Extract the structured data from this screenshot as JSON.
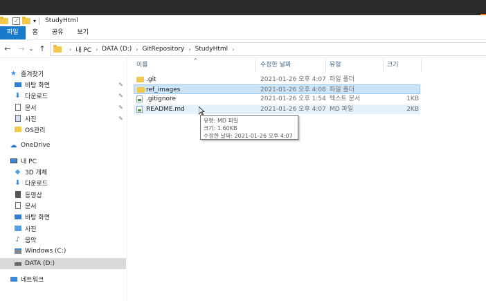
{
  "window": {
    "title": "StudyHtml"
  },
  "ribbon": {
    "tabs": [
      "파일",
      "홈",
      "공유",
      "보기"
    ]
  },
  "address": {
    "crumbs": [
      "내 PC",
      "DATA (D:)",
      "GitRepository",
      "StudyHtml"
    ]
  },
  "sidebar": {
    "quick_access": "즐겨찾기",
    "quick_items": [
      "바탕 화면",
      "다운로드",
      "문서",
      "사진",
      "OS관리"
    ],
    "onedrive": "OneDrive",
    "this_pc": "내 PC",
    "pc_items": [
      "3D 개체",
      "다운로드",
      "동영상",
      "문서",
      "바탕 화면",
      "사진",
      "음악",
      "Windows (C:)",
      "DATA (D:)"
    ],
    "network": "네트워크"
  },
  "columns": {
    "name": "이름",
    "date": "수정한 날짜",
    "type": "유형",
    "size": "크기"
  },
  "files": [
    {
      "name": ".git",
      "date": "2021-01-26 오후 4:07",
      "type": "파일 폴더",
      "size": ""
    },
    {
      "name": "ref_images",
      "date": "2021-01-26 오후 4:08",
      "type": "파일 폴더",
      "size": ""
    },
    {
      "name": ".gitignore",
      "date": "2021-01-26 오후 1:54",
      "type": "텍스트 문서",
      "size": "1KB"
    },
    {
      "name": "README.md",
      "date": "2021-01-26 오후 4:07",
      "type": "MD 파일",
      "size": "2KB"
    }
  ],
  "tooltip": {
    "line1": "유형: MD 파일",
    "line2": "크기: 1.60KB",
    "line3": "수정한 날짜: 2021-01-26 오후 4:07"
  },
  "colors": {
    "accent": "#1979ca",
    "selection": "#cce4f7",
    "hover": "#e5f1fb",
    "folder": "#f2c94c"
  }
}
